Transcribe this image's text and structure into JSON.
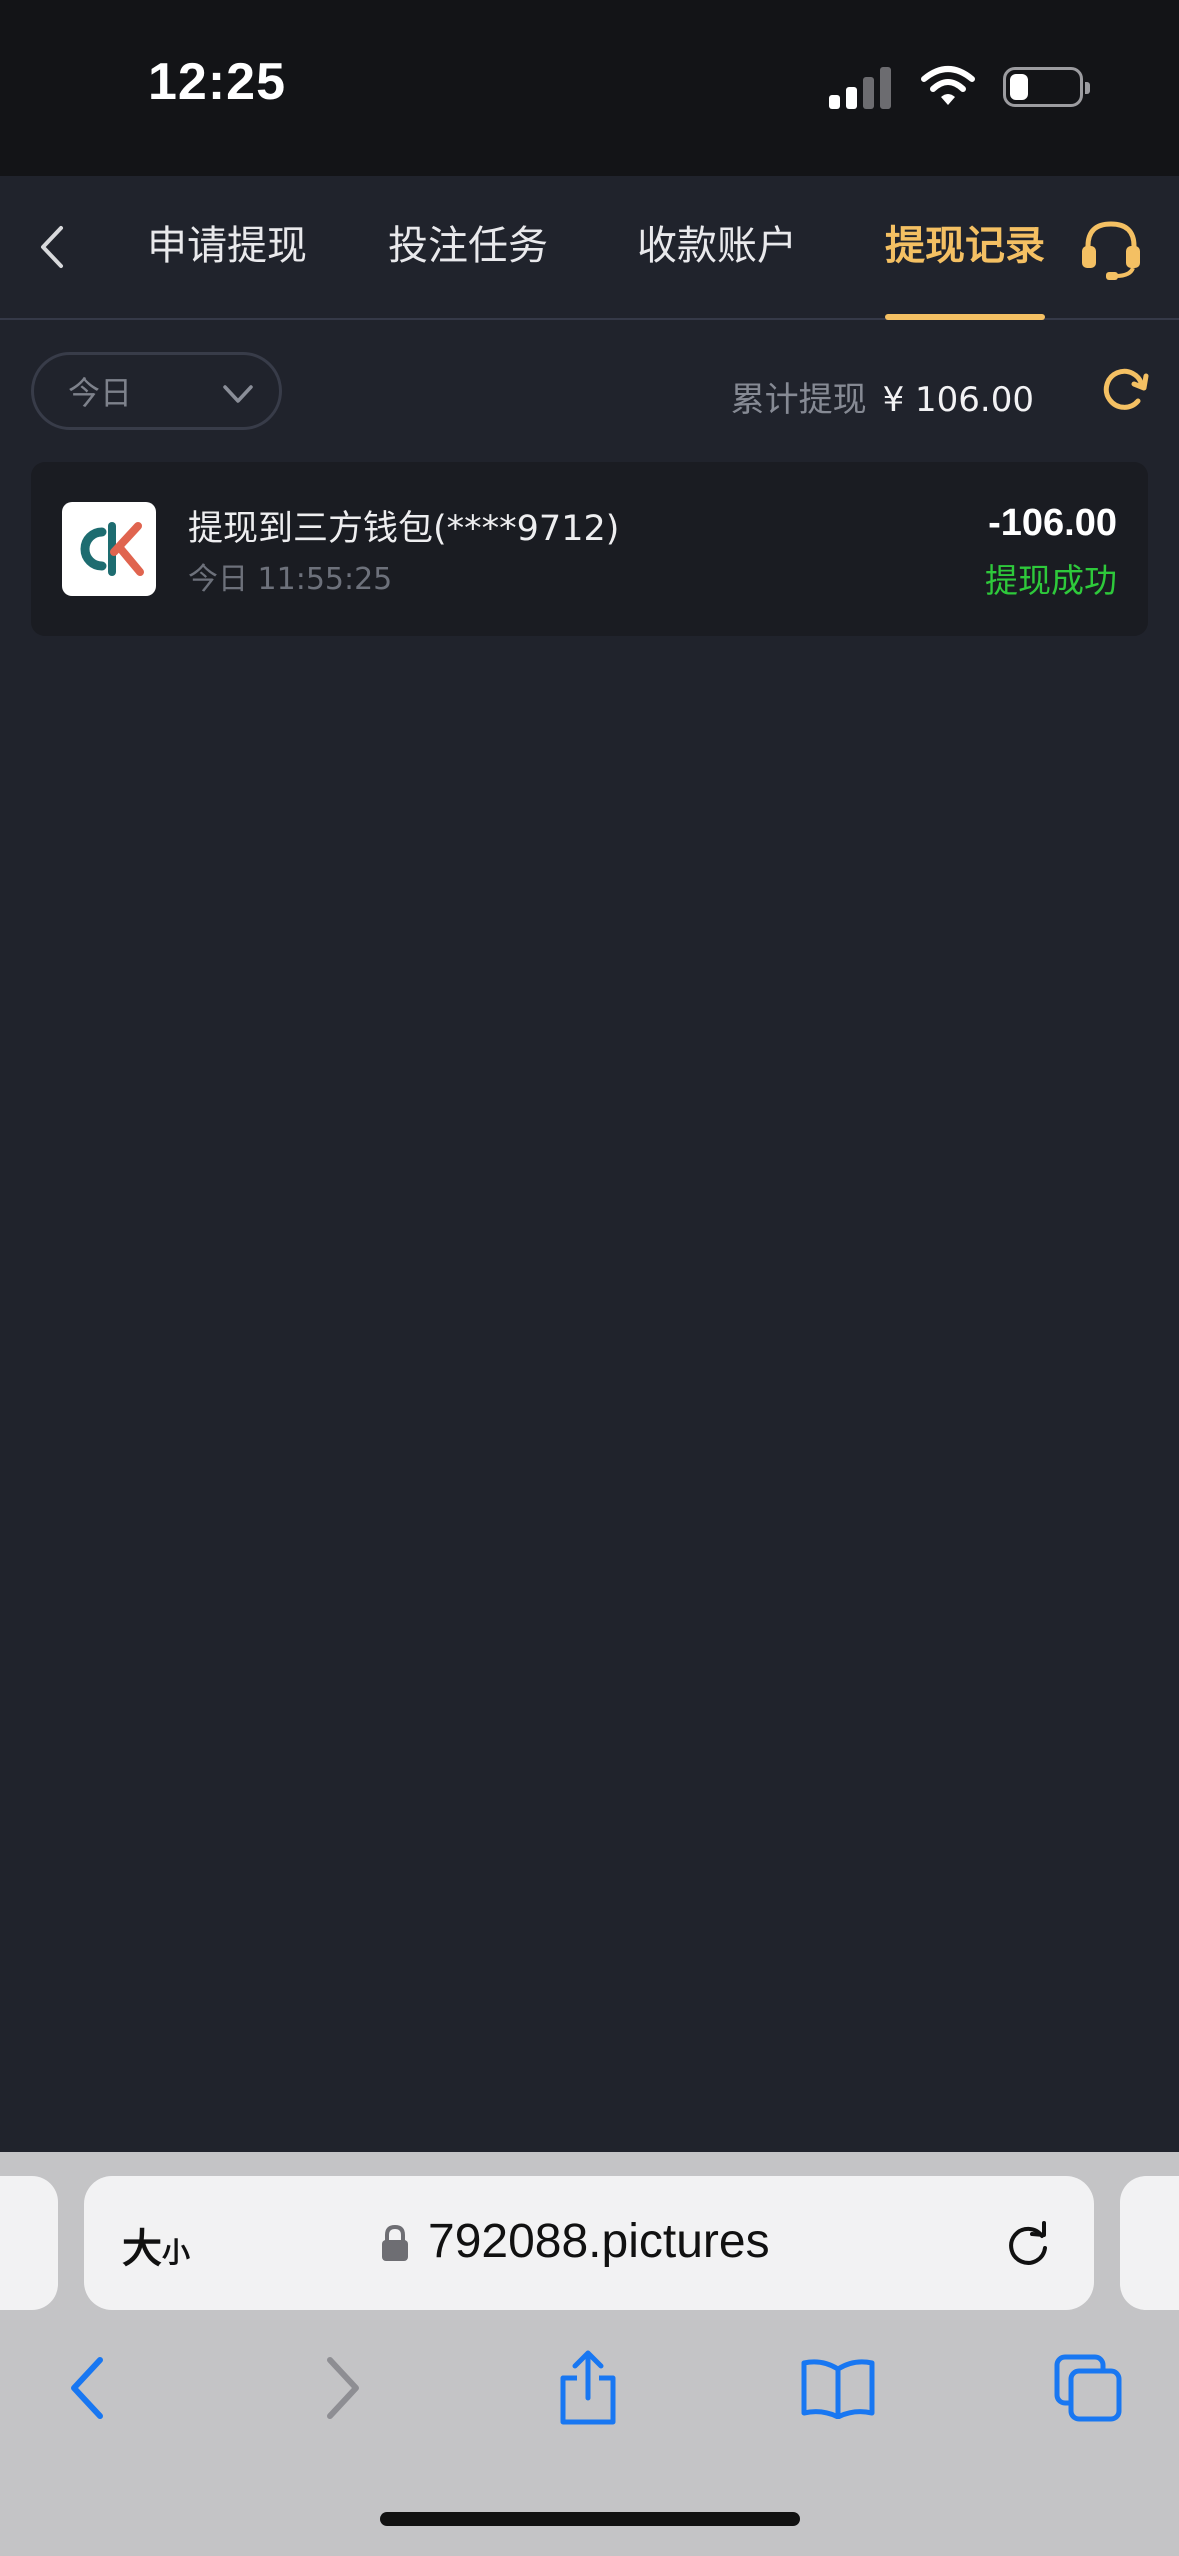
{
  "status_bar": {
    "time": "12:25"
  },
  "nav": {
    "tabs": [
      {
        "label": "申请提现",
        "active": false
      },
      {
        "label": "投注任务",
        "active": false
      },
      {
        "label": "收款账户",
        "active": false
      },
      {
        "label": "提现记录",
        "active": true
      }
    ]
  },
  "filter": {
    "date_select": "今日",
    "total_label": "累计提现",
    "total_amount": "¥ 106.00"
  },
  "records": [
    {
      "title": "提现到三方钱包(****9712)",
      "time": "今日 11:55:25",
      "amount": "-106.00",
      "status": "提现成功"
    }
  ],
  "browser": {
    "text_size_label": "大",
    "text_size_small": "小",
    "url": "792088.pictures"
  },
  "colors": {
    "accent": "#f4c063",
    "success": "#2ec93b",
    "background": "#20232c",
    "card": "#1a1c22"
  },
  "icons": [
    "back-icon",
    "headset-icon",
    "chevron-down-icon",
    "refresh-icon",
    "lock-icon",
    "reload-icon",
    "safari-back-icon",
    "safari-forward-icon",
    "share-icon",
    "bookmarks-icon",
    "tabs-icon"
  ]
}
